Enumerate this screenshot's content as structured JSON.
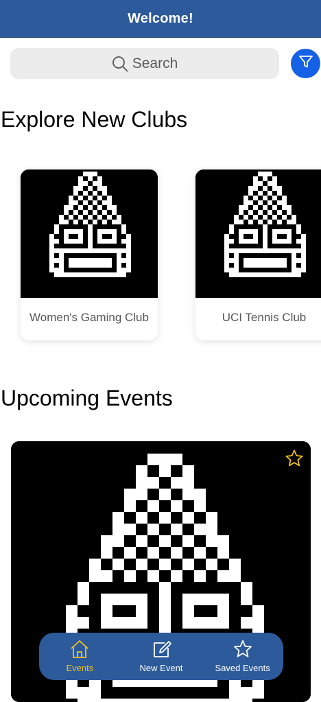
{
  "header": {
    "title": "Welcome!"
  },
  "search": {
    "placeholder": "Search",
    "icon": "search-icon"
  },
  "filter": {
    "icon": "filter-icon"
  },
  "clubs": {
    "title": "Explore New Clubs",
    "items": [
      {
        "name": "Women's Gaming Club"
      },
      {
        "name": "UCI Tennis Club"
      }
    ]
  },
  "events": {
    "title": "Upcoming Events",
    "items": [
      {
        "saved": false,
        "icon": "star-outline-icon"
      }
    ]
  },
  "nav": {
    "items": [
      {
        "label": "Events",
        "icon": "home-icon",
        "active": true
      },
      {
        "label": "New Event",
        "icon": "edit-icon",
        "active": false
      },
      {
        "label": "Saved Events",
        "icon": "star-icon",
        "active": false
      }
    ]
  },
  "colors": {
    "primary": "#2c5a9a",
    "filter_button": "#1561e6",
    "active_nav": "#f7c21c",
    "star": "#f7c21c"
  }
}
